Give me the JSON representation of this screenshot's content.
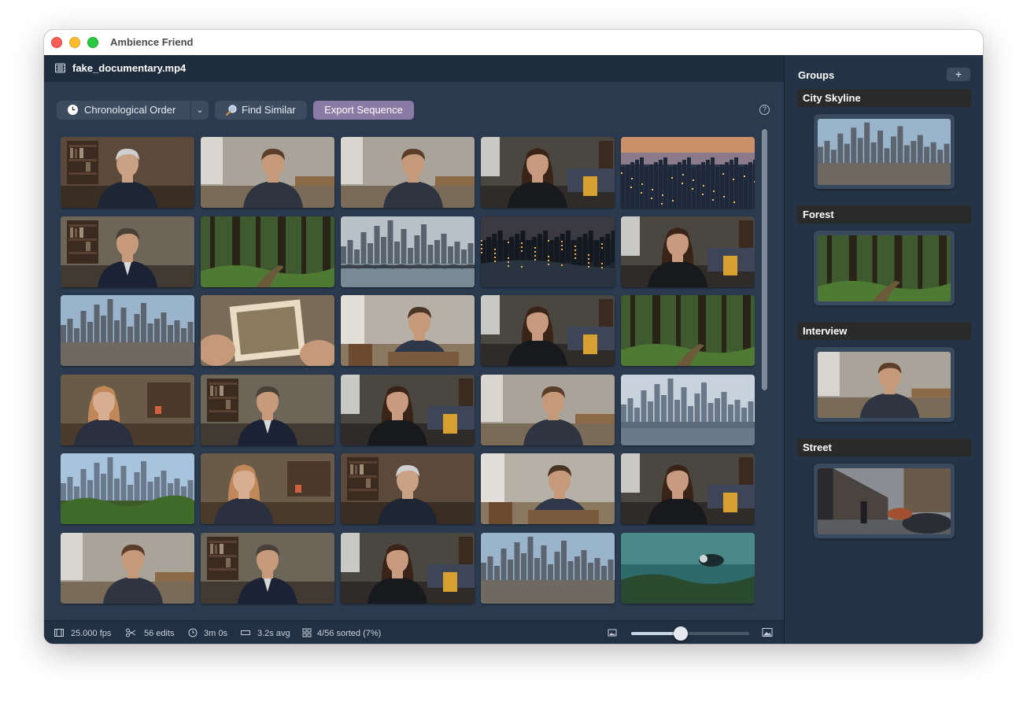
{
  "window": {
    "title": "Ambience Friend"
  },
  "file": {
    "name": "fake_documentary.mp4"
  },
  "toolbar": {
    "order_label": "Chronological Order",
    "find_similar_label": "Find Similar",
    "export_label": "Export Sequence",
    "help": "?"
  },
  "thumbnails": [
    [
      "interview-older-man",
      "interview-young-man",
      "interview-young-man",
      "interview-woman",
      "city-dusk"
    ],
    [
      "interview-man-suit",
      "forest",
      "city-skyline-bridge",
      "city-night",
      "interview-woman"
    ],
    [
      "city-skyline",
      "old-photo",
      "interview-young-man-seated",
      "interview-woman",
      "forest"
    ],
    [
      "interview-blonde-woman",
      "interview-man-suit",
      "interview-woman",
      "interview-young-man",
      "city-skyline-river"
    ],
    [
      "city-skyline-greenery",
      "interview-blonde-woman",
      "interview-older-man",
      "interview-young-man-seated",
      "interview-woman"
    ],
    [
      "interview-young-man",
      "interview-man-suit",
      "interview-woman",
      "city-skyline",
      "underwater-diver"
    ]
  ],
  "status": {
    "fps": "25.000 fps",
    "edits": "56 edits",
    "duration": "3m 0s",
    "avg": "3.2s avg",
    "sorted": "4/56 sorted (7%)",
    "zoom_level": 0.42
  },
  "sidebar": {
    "title": "Groups",
    "add_label": "+",
    "groups": [
      {
        "name": "City Skyline",
        "thumb": "city-skyline"
      },
      {
        "name": "Forest",
        "thumb": "forest"
      },
      {
        "name": "Interview",
        "thumb": "interview-young-man"
      },
      {
        "name": "Street",
        "thumb": "street-rain"
      }
    ]
  },
  "colors": {
    "accent": "#8a7ba6",
    "background": "#2b3a4e",
    "sidebar": "#253346"
  }
}
